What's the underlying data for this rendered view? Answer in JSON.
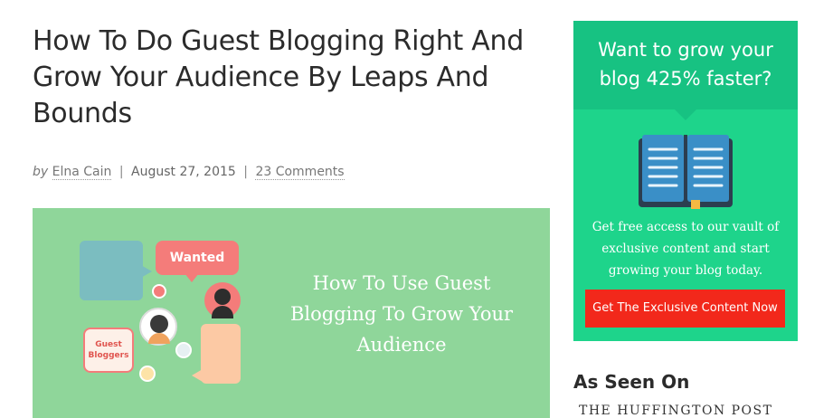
{
  "post": {
    "title": "How To Do Guest Blogging Right And Grow Your Audience By Leaps And Bounds",
    "meta": {
      "by_label": "by",
      "author": "Elna Cain",
      "separator": "|",
      "date": "August 27, 2015",
      "comments": "23 Comments"
    },
    "hero": {
      "text": "How To Use Guest Blogging To Grow Your Audience",
      "wanted_label": "Wanted",
      "guest_label_1": "Guest",
      "guest_label_2": "Bloggers",
      "background_color": "#8fd69a"
    }
  },
  "sidebar": {
    "optin": {
      "heading": "Want to grow your blog 425% faster?",
      "description": "Get free access to our vault of exclusive content and start growing your blog today.",
      "button_label": "Get The Exclusive Content Now",
      "icon": "book-icon",
      "colors": {
        "background": "#1ed48b",
        "button": "#f2281b"
      }
    },
    "seen_on": {
      "heading": "As Seen On",
      "logos": [
        "THE HUFFINGTON POST"
      ]
    }
  }
}
